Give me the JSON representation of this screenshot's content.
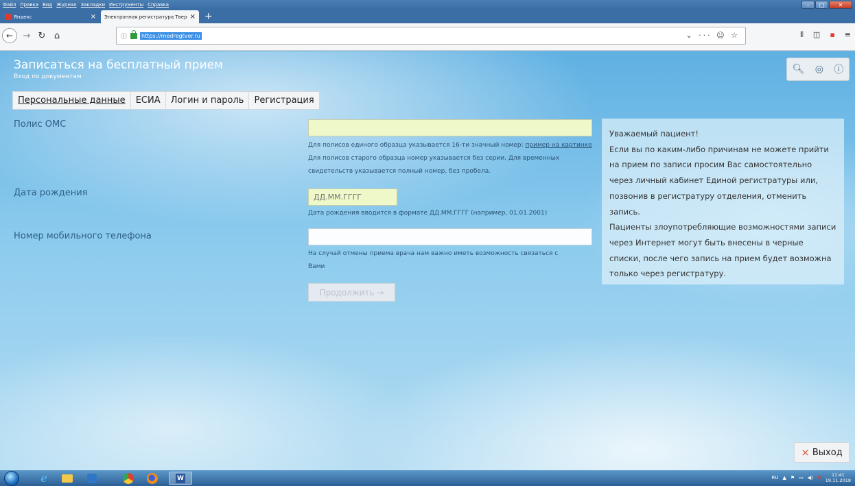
{
  "browser": {
    "menu": [
      "Файл",
      "Правка",
      "Вид",
      "Журнал",
      "Закладки",
      "Инструменты",
      "Справка"
    ],
    "tabs": [
      {
        "title": "Яндекс",
        "active": false
      },
      {
        "title": "Электронная регистратура Тверс",
        "active": true
      }
    ],
    "new_tab": "+",
    "url": "https://medregtver.ru",
    "url_actions": "⌄ ··· ☺ ☆",
    "window_controls": [
      "–",
      "□",
      "✕"
    ]
  },
  "page": {
    "title": "Записаться на бесплатный прием",
    "subtitle": "Вход по документам",
    "tabs": [
      "Персональные данные",
      "ЕСИА",
      "Логин и пароль",
      "Регистрация"
    ],
    "form": {
      "oms_label": "Полис ОМС",
      "oms_value": "",
      "oms_hint_prefix": "Для полисов единого образца указывается 16-ти значный номер: ",
      "oms_hint_link": "пример на картинке",
      "oms_hint_suffix": " Для полисов старого образца номер указывается без серии. Для временных свидетельств указывается полный номер, без пробела.",
      "birth_label": "Дата рождения",
      "birth_placeholder": "ДД.ММ.ГГГГ",
      "birth_hint": "Дата рождения вводится в формате ДД.ММ.ГГГГ (например, 01.01.2001)",
      "phone_label": "Номер мобильного телефона",
      "phone_value": "",
      "phone_hint": "На случай отмены приема врача нам важно иметь возможность связаться с Вами",
      "continue_button": "Продолжить →"
    },
    "notice": {
      "line1": "Уважаемый пациент!",
      "line2": "Если вы по каким-либо причинам не можете прийти на прием по записи просим Вас самостоятельно через личный кабинет Единой регистратуры или, позвонив в регистратуру отделения, отменить запись.",
      "line3": "Пациенты злоупотребляющие возможностями записи через Интернет могут быть внесены в черные списки, после чего запись на прием будет возможна только через регистратуру."
    },
    "exit_button": "Выход"
  },
  "taskbar": {
    "lang": "RU",
    "time": "11:41",
    "date": "19.11.2018"
  }
}
